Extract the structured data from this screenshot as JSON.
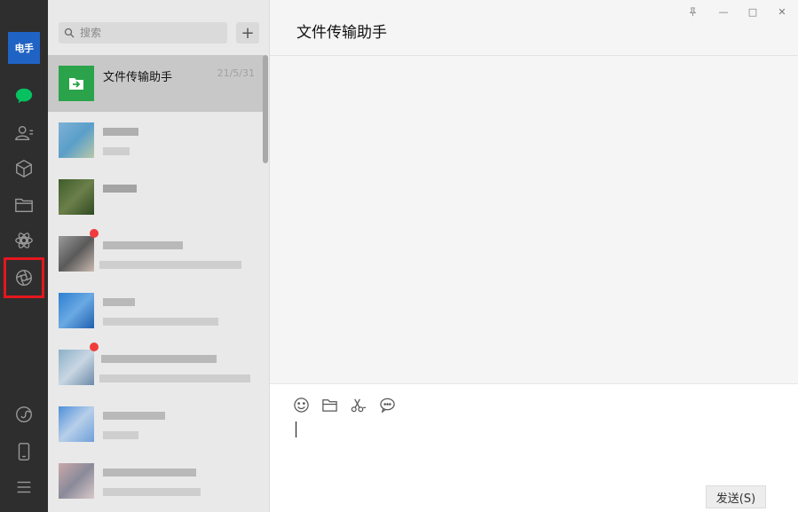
{
  "rail": {
    "avatar_text": "电手",
    "icons": [
      "chat-icon",
      "contacts-icon",
      "favorites-icon",
      "files-icon",
      "moments-icon",
      "channels-icon",
      "miniprogram-icon",
      "phone-icon",
      "menu-icon"
    ],
    "highlight_color": "#e5161d",
    "active_color": "#07c160"
  },
  "search": {
    "placeholder": "搜索",
    "add_label": "+"
  },
  "chats": [
    {
      "name": "文件传输助手",
      "time": "21/5/31"
    }
  ],
  "main": {
    "title": "文件传输助手",
    "send_label": "发送(S)"
  },
  "window_controls": {
    "pin": "pin-icon",
    "minimize": "—",
    "maximize": "□",
    "close": "✕"
  }
}
